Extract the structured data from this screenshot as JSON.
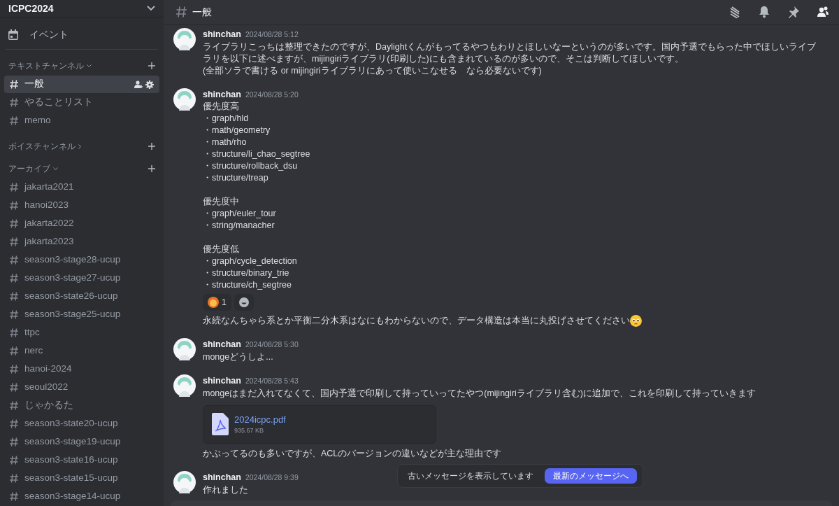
{
  "server": {
    "name": "ICPC2024"
  },
  "sidebar": {
    "events_label": "イベント",
    "categories": [
      {
        "name": "テキストチャンネル",
        "expanded": true,
        "channels": [
          {
            "name": "一般",
            "selected": true
          },
          {
            "name": "やることリスト",
            "selected": false
          },
          {
            "name": "memo",
            "selected": false
          }
        ]
      },
      {
        "name": "ボイスチャンネル",
        "expanded": false
      },
      {
        "name": "アーカイブ",
        "expanded": true,
        "channels": [
          {
            "name": "jakarta2021",
            "selected": false
          },
          {
            "name": "hanoi2023",
            "selected": false
          },
          {
            "name": "jakarta2022",
            "selected": false
          },
          {
            "name": "jakarta2023",
            "selected": false
          },
          {
            "name": "season3-stage28-ucup",
            "selected": false
          },
          {
            "name": "season3-stage27-ucup",
            "selected": false
          },
          {
            "name": "season3-state26-ucup",
            "selected": false
          },
          {
            "name": "season3-stage25-ucup",
            "selected": false
          },
          {
            "name": "ttpc",
            "selected": false
          },
          {
            "name": "nerc",
            "selected": false
          },
          {
            "name": "hanoi-2024",
            "selected": false
          },
          {
            "name": "seoul2022",
            "selected": false
          },
          {
            "name": "じゃかるた",
            "selected": false
          },
          {
            "name": "season3-state20-ucup",
            "selected": false
          },
          {
            "name": "season3-stage19-ucup",
            "selected": false
          },
          {
            "name": "season3-state16-ucup",
            "selected": false
          },
          {
            "name": "season3-state15-ucup",
            "selected": false
          },
          {
            "name": "season3-stage14-ucup",
            "selected": false
          }
        ]
      }
    ]
  },
  "channel_header": {
    "name": "一般",
    "buttons": [
      {
        "kind": "threads",
        "selected": false
      },
      {
        "kind": "bell",
        "selected": false
      },
      {
        "kind": "pin",
        "selected": false
      },
      {
        "kind": "members",
        "selected": true
      }
    ]
  },
  "messages": [
    {
      "author": "shinchan",
      "time": "2024/08/28 5:12",
      "paragraphs": [
        [
          "ライブラリこっちは整理できたのですが、Daylightくんがもってるやつもわりとほしいなーというのが多いです。国内予選でもらった中でほしいライブラリを以下に述べますが、mijingiriライブラリ(印刷した)にも含まれているのが多いので、そこは判断してほしいです。",
          "(全部ソラで書ける or mijingiriライブラリにあって使いこなせる　なら必要ないです)"
        ]
      ]
    },
    {
      "author": "shinchan",
      "time": "2024/08/28 5:20",
      "paragraphs": [
        [
          "優先度高",
          "・graph/hld",
          "・math/geometry",
          "・math/rho",
          "・structure/li_chao_segtree",
          "・structure/rollback_dsu",
          "・structure/treap"
        ],
        [
          "優先度中",
          "・graph/euler_tour",
          "・string/manacher"
        ],
        [
          "優先度低",
          "・graph/cycle_detection",
          "・structure/binary_trie",
          "・structure/ch_segtree"
        ]
      ],
      "reactions": [
        {
          "count": "1"
        }
      ],
      "followups": [
        {
          "text": "永続なんちゃら系とか平衡二分木系はなにもわからないので、データ構造は本当に丸投げさせてください",
          "emoji": true
        }
      ]
    },
    {
      "author": "shinchan",
      "time": "2024/08/28 5:30",
      "paragraphs": [
        [
          "mongeどうしよ..."
        ]
      ]
    },
    {
      "author": "shinchan",
      "time": "2024/08/28 5:43",
      "paragraphs": [
        [
          "mongeはまだ入れてなくて、国内予選で印刷して持っていってたやつ(mijingiriライブラリ含む)に追加で、これを印刷して持っていきます"
        ]
      ],
      "attachment": {
        "filename": "2024icpc.pdf",
        "size": "935.67 KB"
      },
      "followups": [
        {
          "text": "かぶってるのも多いですが、ACLのバージョンの違いなどが主な理由です",
          "emoji": false
        }
      ]
    },
    {
      "author": "shinchan",
      "time": "2024/08/28 9:39",
      "paragraphs": [
        [
          "作れました"
        ]
      ]
    }
  ],
  "notice": {
    "text": "古いメッセージを表示しています",
    "button": "最新のメッセージへ"
  }
}
